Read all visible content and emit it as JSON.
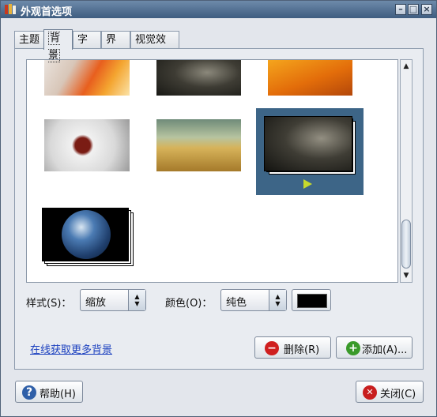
{
  "window": {
    "title": "外观首选项"
  },
  "tabs": [
    {
      "label": "主题"
    },
    {
      "label": "背景"
    },
    {
      "label": "字体"
    },
    {
      "label": "界面"
    },
    {
      "label": "视觉效果"
    }
  ],
  "style": {
    "label": "样式(S)：",
    "value": "缩放"
  },
  "color": {
    "label": "颜色(O)：",
    "value": "纯色",
    "swatch": "#000000"
  },
  "online_link": "在线获取更多背景",
  "buttons": {
    "delete": "删除(R)",
    "add": "添加(A)...",
    "help": "帮助(H)",
    "close": "关闭(C)"
  },
  "colors": {
    "selection": "#3d6587",
    "link": "#1a3fbf"
  }
}
